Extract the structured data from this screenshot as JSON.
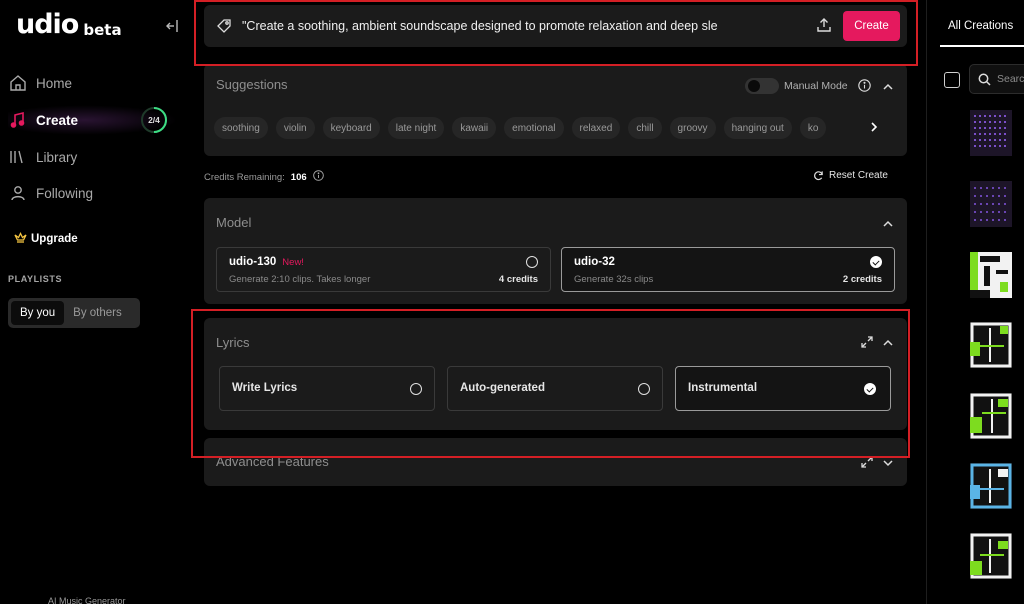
{
  "app": {
    "logo_text": "udio",
    "logo_badge": "beta",
    "footer": "AI Music Generator"
  },
  "sidebar": {
    "items": [
      {
        "label": "Home",
        "icon": "home-icon",
        "active": false
      },
      {
        "label": "Create",
        "icon": "music-note-icon",
        "active": true,
        "progress": "2/4"
      },
      {
        "label": "Library",
        "icon": "library-icon",
        "active": false
      },
      {
        "label": "Following",
        "icon": "person-icon",
        "active": false
      }
    ],
    "upgrade_label": "Upgrade",
    "playlists_label": "PLAYLISTS",
    "playlist_tabs": [
      "By you",
      "By others"
    ]
  },
  "prompt": {
    "text": "\"Create a soothing, ambient soundscape designed to promote relaxation and deep sle",
    "create_label": "Create"
  },
  "suggestions": {
    "title": "Suggestions",
    "manual_mode_label": "Manual Mode",
    "chips": [
      "soothing",
      "violin",
      "keyboard",
      "late night",
      "kawaii",
      "emotional",
      "relaxed",
      "chill",
      "groovy",
      "hanging out",
      "ko"
    ]
  },
  "credits": {
    "label": "Credits Remaining:",
    "value": "106",
    "reset_label": "Reset Create"
  },
  "model": {
    "title": "Model",
    "options": [
      {
        "name": "udio-130",
        "badge": "New!",
        "desc": "Generate 2:10 clips. Takes longer",
        "cost": "4 credits",
        "selected": false
      },
      {
        "name": "udio-32",
        "badge": "",
        "desc": "Generate 32s clips",
        "cost": "2 credits",
        "selected": true
      }
    ]
  },
  "lyrics": {
    "title": "Lyrics",
    "options": [
      {
        "label": "Write Lyrics",
        "selected": false
      },
      {
        "label": "Auto-generated",
        "selected": false
      },
      {
        "label": "Instrumental",
        "selected": true
      }
    ]
  },
  "advanced": {
    "title": "Advanced Features"
  },
  "right_panel": {
    "tab_label": "All Creations",
    "search_placeholder": "Search"
  },
  "colors": {
    "accent": "#e5195e",
    "highlight_box": "#d41f25",
    "progress_ring": "#3ddc84"
  }
}
